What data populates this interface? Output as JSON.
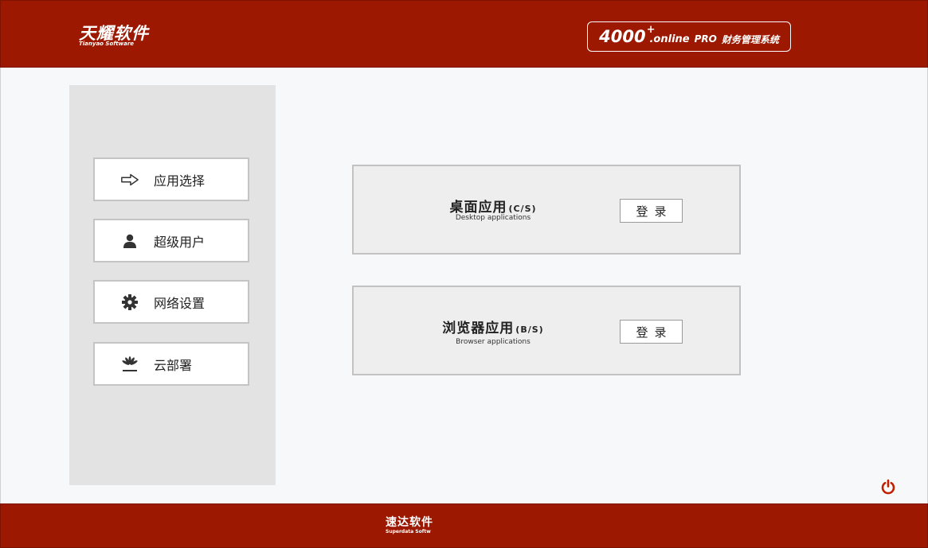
{
  "header": {
    "logo_cn": "天耀软件",
    "logo_en": "Tianyao Software",
    "product": {
      "num": "4000",
      "sup": "+",
      "online": ".online",
      "pro": "PRO",
      "cn": "财务管理系统"
    }
  },
  "sidebar": {
    "items": [
      {
        "label": "应用选择",
        "icon": "arrow-right-icon"
      },
      {
        "label": "超级用户",
        "icon": "user-icon"
      },
      {
        "label": "网络设置",
        "icon": "gear-icon"
      },
      {
        "label": "云部署",
        "icon": "huawei-logo-icon"
      }
    ]
  },
  "apps": [
    {
      "title": "桌面应用",
      "suffix": "(C/S)",
      "subtitle": "Desktop applications",
      "login_label": "登录"
    },
    {
      "title": "浏览器应用",
      "suffix": "(B/S)",
      "subtitle": "Browser applications",
      "login_label": "登录"
    }
  ],
  "footer": {
    "logo_cn": "速达软件",
    "logo_en": "Superdata Softw"
  },
  "colors": {
    "brand_red": "#9c1800",
    "power_red": "#c02000"
  }
}
